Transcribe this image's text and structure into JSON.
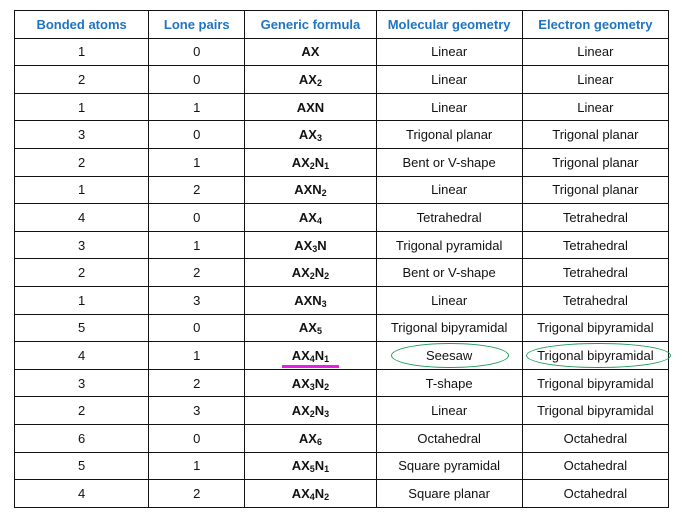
{
  "table": {
    "headers": [
      "Bonded atoms",
      "Lone pairs",
      "Generic formula",
      "Molecular geometry",
      "Electron geometry"
    ],
    "rows": [
      {
        "bonded": "1",
        "lone": "0",
        "formula": [
          [
            "AX",
            ""
          ]
        ],
        "molecular": "Linear",
        "electron": "Linear"
      },
      {
        "bonded": "2",
        "lone": "0",
        "formula": [
          [
            "AX",
            "2"
          ]
        ],
        "molecular": "Linear",
        "electron": "Linear"
      },
      {
        "bonded": "1",
        "lone": "1",
        "formula": [
          [
            "AXN",
            ""
          ]
        ],
        "molecular": "Linear",
        "electron": "Linear"
      },
      {
        "bonded": "3",
        "lone": "0",
        "formula": [
          [
            "AX",
            "3"
          ]
        ],
        "molecular": "Trigonal planar",
        "electron": "Trigonal planar"
      },
      {
        "bonded": "2",
        "lone": "1",
        "formula": [
          [
            "AX",
            "2"
          ],
          [
            "N",
            "1"
          ]
        ],
        "molecular": "Bent or V-shape",
        "electron": "Trigonal planar"
      },
      {
        "bonded": "1",
        "lone": "2",
        "formula": [
          [
            "AXN",
            "2"
          ]
        ],
        "molecular": "Linear",
        "electron": "Trigonal planar"
      },
      {
        "bonded": "4",
        "lone": "0",
        "formula": [
          [
            "AX",
            "4"
          ]
        ],
        "molecular": "Tetrahedral",
        "electron": "Tetrahedral"
      },
      {
        "bonded": "3",
        "lone": "1",
        "formula": [
          [
            "AX",
            "3"
          ],
          [
            "N",
            ""
          ]
        ],
        "molecular": "Trigonal pyramidal",
        "electron": "Tetrahedral"
      },
      {
        "bonded": "2",
        "lone": "2",
        "formula": [
          [
            "AX",
            "2"
          ],
          [
            "N",
            "2"
          ]
        ],
        "molecular": "Bent or V-shape",
        "electron": "Tetrahedral"
      },
      {
        "bonded": "1",
        "lone": "3",
        "formula": [
          [
            "AXN",
            "3"
          ]
        ],
        "molecular": "Linear",
        "electron": "Tetrahedral"
      },
      {
        "bonded": "5",
        "lone": "0",
        "formula": [
          [
            "AX",
            "5"
          ]
        ],
        "molecular": "Trigonal bipyramidal",
        "electron": "Trigonal bipyramidal"
      },
      {
        "bonded": "4",
        "lone": "1",
        "formula": [
          [
            "AX",
            "4"
          ],
          [
            "N",
            "1"
          ]
        ],
        "molecular": "Seesaw",
        "electron": "Trigonal bipyramidal",
        "highlighted": true
      },
      {
        "bonded": "3",
        "lone": "2",
        "formula": [
          [
            "AX",
            "3"
          ],
          [
            "N",
            "2"
          ]
        ],
        "molecular": "T-shape",
        "electron": "Trigonal bipyramidal"
      },
      {
        "bonded": "2",
        "lone": "3",
        "formula": [
          [
            "AX",
            "2"
          ],
          [
            "N",
            "3"
          ]
        ],
        "molecular": "Linear",
        "electron": "Trigonal bipyramidal"
      },
      {
        "bonded": "6",
        "lone": "0",
        "formula": [
          [
            "AX",
            "6"
          ]
        ],
        "molecular": "Octahedral",
        "electron": "Octahedral"
      },
      {
        "bonded": "5",
        "lone": "1",
        "formula": [
          [
            "AX",
            "5"
          ],
          [
            "N",
            "1"
          ]
        ],
        "molecular": "Square pyramidal",
        "electron": "Octahedral"
      },
      {
        "bonded": "4",
        "lone": "2",
        "formula": [
          [
            "AX",
            "4"
          ],
          [
            "N",
            "2"
          ]
        ],
        "molecular": "Square planar",
        "electron": "Octahedral"
      }
    ]
  },
  "colors": {
    "header_text": "#1f74c2",
    "formula_text": "#c00000",
    "underline_annotation": "#e61ee6",
    "ellipse_annotation": "#1fa05a"
  }
}
